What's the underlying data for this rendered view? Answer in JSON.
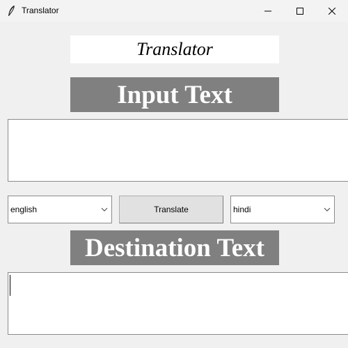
{
  "window": {
    "title": "Translator",
    "icon": "feather-icon",
    "controls": [
      "minimize-icon",
      "maximize-icon",
      "close-icon"
    ]
  },
  "heading": "Translator",
  "input_label": "Input Text",
  "input_text": "",
  "source_language": {
    "selected": "english"
  },
  "translate_button": "Translate",
  "target_language": {
    "selected": "hindi"
  },
  "destination_label": "Destination Text",
  "destination_text": "",
  "colors": {
    "window_bg": "#f0f0f0",
    "label_bg": "#808080",
    "label_fg": "#ffffff",
    "field_bg": "#ffffff"
  }
}
